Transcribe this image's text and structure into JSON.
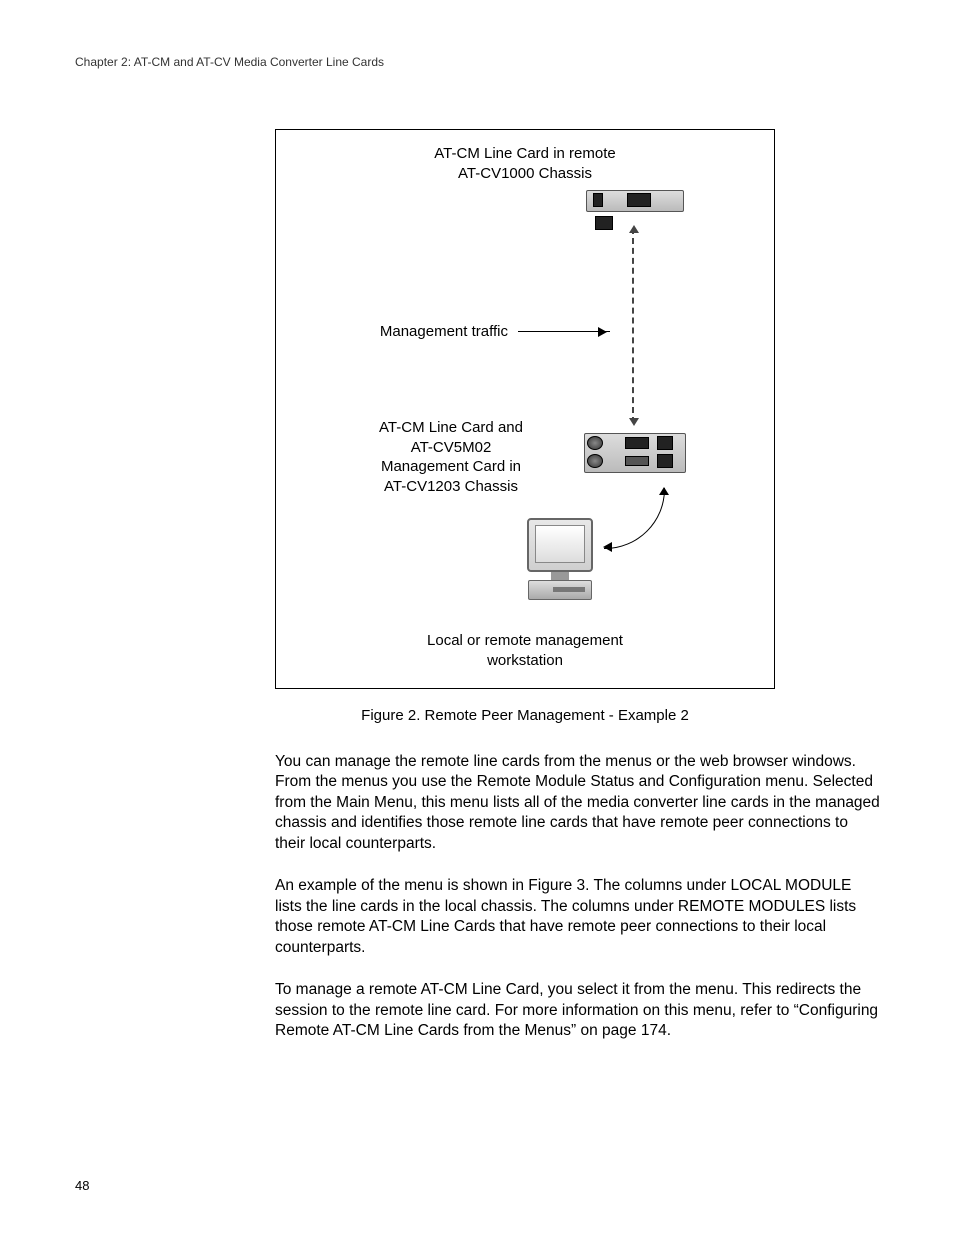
{
  "chapter_header": "Chapter 2: AT-CM and AT-CV Media Converter Line Cards",
  "figure": {
    "label_top": "AT-CM Line Card in remote\nAT-CV1000 Chassis",
    "label_mgmt_traffic": "Management traffic",
    "label_mid": "AT-CM Line Card and\nAT-CV5M02\nManagement Card in\nAT-CV1203 Chassis",
    "label_bottom": "Local or remote management\nworkstation",
    "caption": "Figure 2. Remote Peer Management - Example 2"
  },
  "paragraphs": {
    "p1": "You can manage the remote line cards from the menus or the web browser windows. From the menus you use the Remote Module Status and Configuration menu. Selected from the Main Menu, this menu lists all of the media converter line cards in the managed chassis and identifies those remote line cards that have remote peer connections to their local counterparts.",
    "p2": "An example of the menu is shown in Figure 3. The columns under LOCAL MODULE lists the line cards in the local chassis. The columns under REMOTE MODULES lists those remote AT-CM Line Cards that have remote peer connections to their local counterparts.",
    "p3": "To manage a remote AT-CM Line Card, you select it from the menu. This redirects the session to the remote line card. For more information on this menu, refer to “Configuring Remote AT-CM Line Cards from the Menus” on page 174."
  },
  "page_number": "48"
}
